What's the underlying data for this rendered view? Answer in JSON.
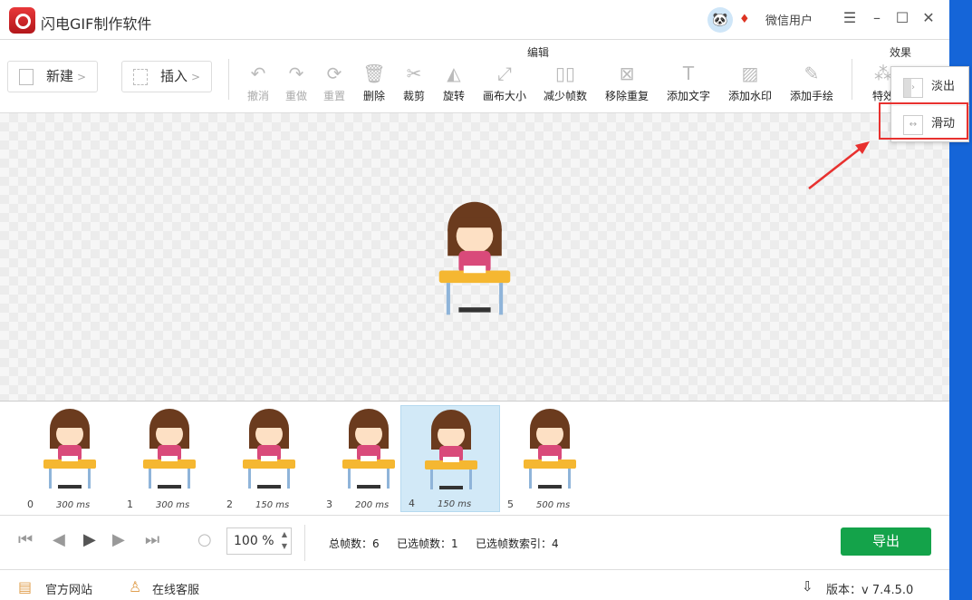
{
  "app": {
    "title": "闪电GIF制作软件",
    "user": "微信用户"
  },
  "toolbar": {
    "new_label": "新建",
    "insert_label": "插入",
    "group_edit": "编辑",
    "group_effect": "效果",
    "tools": [
      {
        "label": "撤消",
        "icon": "undo-icon",
        "disabled": true
      },
      {
        "label": "重做",
        "icon": "redo-icon",
        "disabled": true
      },
      {
        "label": "重置",
        "icon": "reset-icon",
        "disabled": true
      },
      {
        "label": "删除",
        "icon": "delete-icon"
      },
      {
        "label": "裁剪",
        "icon": "crop-icon"
      },
      {
        "label": "旋转",
        "icon": "rotate-icon"
      },
      {
        "label": "画布大小",
        "icon": "canvas-size-icon"
      },
      {
        "label": "减少帧数",
        "icon": "reduce-frames-icon"
      },
      {
        "label": "移除重复",
        "icon": "remove-duplicate-icon"
      },
      {
        "label": "添加文字",
        "icon": "text-icon"
      },
      {
        "label": "添加水印",
        "icon": "watermark-icon"
      },
      {
        "label": "添加手绘",
        "icon": "pencil-icon"
      },
      {
        "label": "特效",
        "icon": "effects-icon"
      }
    ]
  },
  "effect_menu": {
    "items": [
      "淡出",
      "滑动"
    ]
  },
  "frames": [
    {
      "index": "0",
      "ms": "300 ms"
    },
    {
      "index": "1",
      "ms": "300 ms"
    },
    {
      "index": "2",
      "ms": "150 ms"
    },
    {
      "index": "3",
      "ms": "200 ms"
    },
    {
      "index": "4",
      "ms": "150 ms",
      "selected": true
    },
    {
      "index": "5",
      "ms": "500 ms"
    }
  ],
  "controls": {
    "zoom": "100",
    "zoom_unit": "%",
    "total": "总帧数：6",
    "selected": "已选帧数：1",
    "selected_index": "已选帧数索引：4",
    "export": "导出"
  },
  "footer": {
    "website": "官方网站",
    "support": "在线客服",
    "version": "版本：v 7.4.5.0"
  },
  "colors": {
    "accent": "#14a34a",
    "highlight": "#e8312f",
    "selected_frame": "#d2e9f7"
  }
}
